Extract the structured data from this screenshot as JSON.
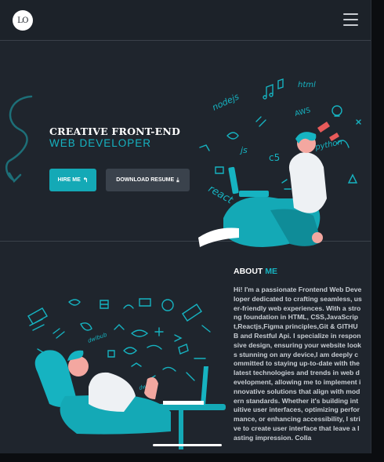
{
  "navbar": {
    "logo_text": "LO",
    "menu_icon": "hamburger-menu-icon"
  },
  "hero": {
    "title_line1": "CREATIVE FRONT-END",
    "title_line2": "WEB  DEVELOPER",
    "hire_label": "HIRE ME",
    "hire_icon": "reply-arrow-icon",
    "resume_label": "DOWNLOAD RESUME",
    "resume_icon": "download-icon",
    "illustration_words": [
      "html",
      "nodejs",
      "AWS",
      "python",
      "js",
      "c5",
      "react"
    ]
  },
  "about": {
    "title_main": "ABOUT ",
    "title_accent": "ME",
    "body": "Hi! I'm a passionate Frontend Web Developer dedicated to crafting seamless, user-friendly web experiences. With a strong foundation in HTML, CSS,JavaScript,Reactjs,Figma principles,Git & GITHUB and Restful Api. I specialize in responsive design, ensuring your website looks stunning on any device,I am deeply committed to staying up-to-date with the latest technologies and trends in web development, allowing me to implement innovative solutions that align with modern standards. Whether it's building intuitive user interfaces, optimizing performance, or enhancing accessibility, I strive to create user interface that leave a lasting impression. Colla"
  },
  "colors": {
    "accent": "#16b3c1",
    "background": "#1f252d",
    "secondary_button": "#3a424c"
  }
}
